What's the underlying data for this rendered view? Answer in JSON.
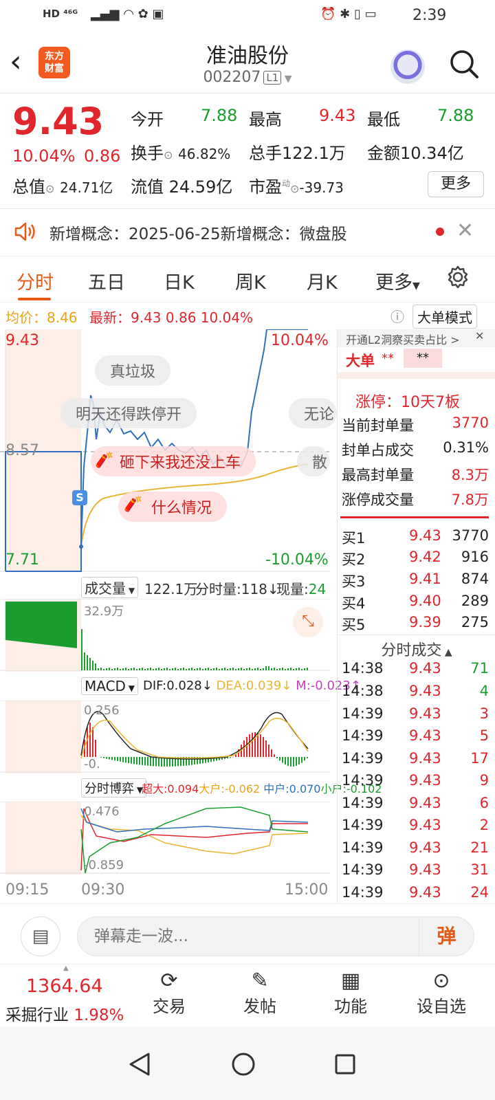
{
  "status_bar": {
    "left": "HD ⁴⁶ᴳ",
    "time": "2:39"
  },
  "header": {
    "logo_text": "东方财富",
    "title": "准油股份",
    "code": "002207",
    "level": "L1"
  },
  "quote": {
    "price": "9.43",
    "change_pct": "10.04%",
    "change": "0.86",
    "open_label": "今开",
    "open": "7.88",
    "high_label": "最高",
    "high": "9.43",
    "low_label": "最低",
    "low": "7.88",
    "turnover_label": "换手",
    "turnover": "46.82%",
    "volume_label": "总手",
    "volume": "122.1万",
    "amount_label": "金额",
    "amount": "10.34亿",
    "mktcap_label": "总值",
    "mktcap": "24.71亿",
    "float_label": "流值",
    "float": "24.59亿",
    "pe_label": "市盈",
    "pe_sup": "动",
    "pe": "-39.73",
    "more": "更多"
  },
  "notice": {
    "label": "新增概念：",
    "text": "2025-06-25新增概念：微盘股"
  },
  "tabs": [
    "分时",
    "五日",
    "日K",
    "周K",
    "月K",
    "更多"
  ],
  "info_line": {
    "avg_label": "均价：",
    "avg": "8.46",
    "latest_label": "最新：",
    "latest": "9.43",
    "chg": "0.86",
    "pct": "10.04%",
    "mode_btn": "大单模式"
  },
  "chart": {
    "y_top": "9.43",
    "y_mid": "8.57",
    "y_bottom": "7.71",
    "pct_top": "10.04%",
    "pct_bottom": "-10.04%",
    "time_start": "09:15",
    "time_open": "09:30",
    "time_end": "15:00",
    "danmu": [
      "真垃圾",
      "明天还得跌停开",
      "无论",
      "砸下来我还没上车",
      "散",
      "什么情况"
    ]
  },
  "volume_panel": {
    "selector": "成交量",
    "total": "122.1万",
    "tick_label": "分时量:118↓",
    "now_label": "现量:",
    "now": "24",
    "max": "32.9万"
  },
  "macd_panel": {
    "selector": "MACD",
    "dif": "DIF:0.028↓",
    "dea": "DEA:0.039↓",
    "m": "M:-0.023↑",
    "top": "0.256",
    "bottom": "-0."
  },
  "game_panel": {
    "selector": "分时博弈",
    "super": "超大:0.094",
    "big": "大户:-0.062",
    "mid": "中户:0.070",
    "small": "小户:-0.102",
    "top": "0.476",
    "bottom": "-0.859"
  },
  "right_panel": {
    "l2_banner": "开通L2洞察买卖占比 >",
    "big_order": "大单",
    "big_vals": [
      "**",
      "**"
    ],
    "limit_label": "涨停：",
    "limit_text": "10天7板",
    "stats": [
      {
        "label": "当前封单量",
        "value": "3770"
      },
      {
        "label": "封单占成交",
        "value": "0.31%"
      },
      {
        "label": "最高封单量",
        "value": "8.3万"
      },
      {
        "label": "涨停成交量",
        "value": "7.8万"
      }
    ],
    "bids": [
      {
        "label": "买1",
        "price": "9.43",
        "vol": "3770"
      },
      {
        "label": "买2",
        "price": "9.42",
        "vol": "916"
      },
      {
        "label": "买3",
        "price": "9.41",
        "vol": "874"
      },
      {
        "label": "买4",
        "price": "9.40",
        "vol": "289"
      },
      {
        "label": "买5",
        "price": "9.39",
        "vol": "275"
      }
    ],
    "ticks_title": "分时成交",
    "ticks": [
      {
        "t": "14:38",
        "p": "9.43",
        "v": "71"
      },
      {
        "t": "14:38",
        "p": "9.43",
        "v": "4"
      },
      {
        "t": "14:39",
        "p": "9.43",
        "v": "3"
      },
      {
        "t": "14:39",
        "p": "9.43",
        "v": "5"
      },
      {
        "t": "14:39",
        "p": "9.43",
        "v": "17"
      },
      {
        "t": "14:39",
        "p": "9.43",
        "v": "9"
      },
      {
        "t": "14:39",
        "p": "9.43",
        "v": "6"
      },
      {
        "t": "14:39",
        "p": "9.43",
        "v": "2"
      },
      {
        "t": "14:39",
        "p": "9.43",
        "v": "21"
      },
      {
        "t": "14:39",
        "p": "9.43",
        "v": "31"
      },
      {
        "t": "14:39",
        "p": "9.43",
        "v": "24"
      }
    ]
  },
  "danmu_bar": {
    "placeholder": "弹幕走一波...",
    "btn": "弹"
  },
  "bottom_nav": {
    "index_value": "1364.64",
    "index_name": "采掘行业",
    "index_pct": "1.98%",
    "items": [
      "交易",
      "发帖",
      "功能",
      "设自选"
    ]
  },
  "colors": {
    "red": "#e0262b",
    "green": "#1a9d2f",
    "accent": "#e55a17",
    "blue": "#2f6fbf",
    "yellow": "#e8b534"
  }
}
